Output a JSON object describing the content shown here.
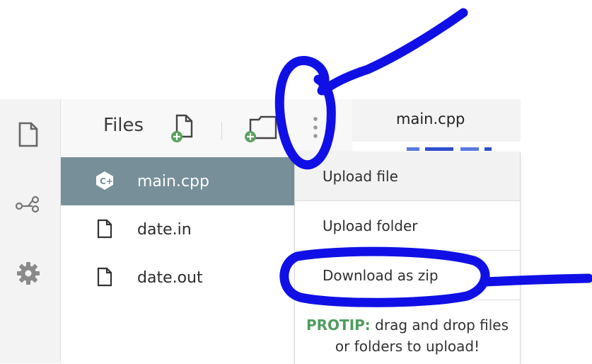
{
  "sidebar": {
    "icons": [
      "file-icon",
      "share-icon",
      "gear-icon"
    ]
  },
  "files_panel": {
    "title": "Files",
    "header_icons": [
      "new-file-icon",
      "new-folder-icon",
      "more-vertical-icon"
    ],
    "files": [
      {
        "name": "main.cpp",
        "icon": "cpp-logo-icon",
        "selected": true
      },
      {
        "name": "date.in",
        "icon": "file-icon",
        "selected": false
      },
      {
        "name": "date.out",
        "icon": "file-icon",
        "selected": false
      }
    ]
  },
  "editor": {
    "tab_label": "main.cpp"
  },
  "menu": {
    "items": [
      {
        "label": "Upload file"
      },
      {
        "label": "Upload folder"
      },
      {
        "label": "Download as zip"
      }
    ],
    "protip": {
      "label": "PROTIP:",
      "text": "drag and drop files or folders to upload!"
    }
  },
  "colors": {
    "selected_row": "#778f99",
    "accent_green": "#4f9c5f",
    "annotation": "#1010e6"
  }
}
